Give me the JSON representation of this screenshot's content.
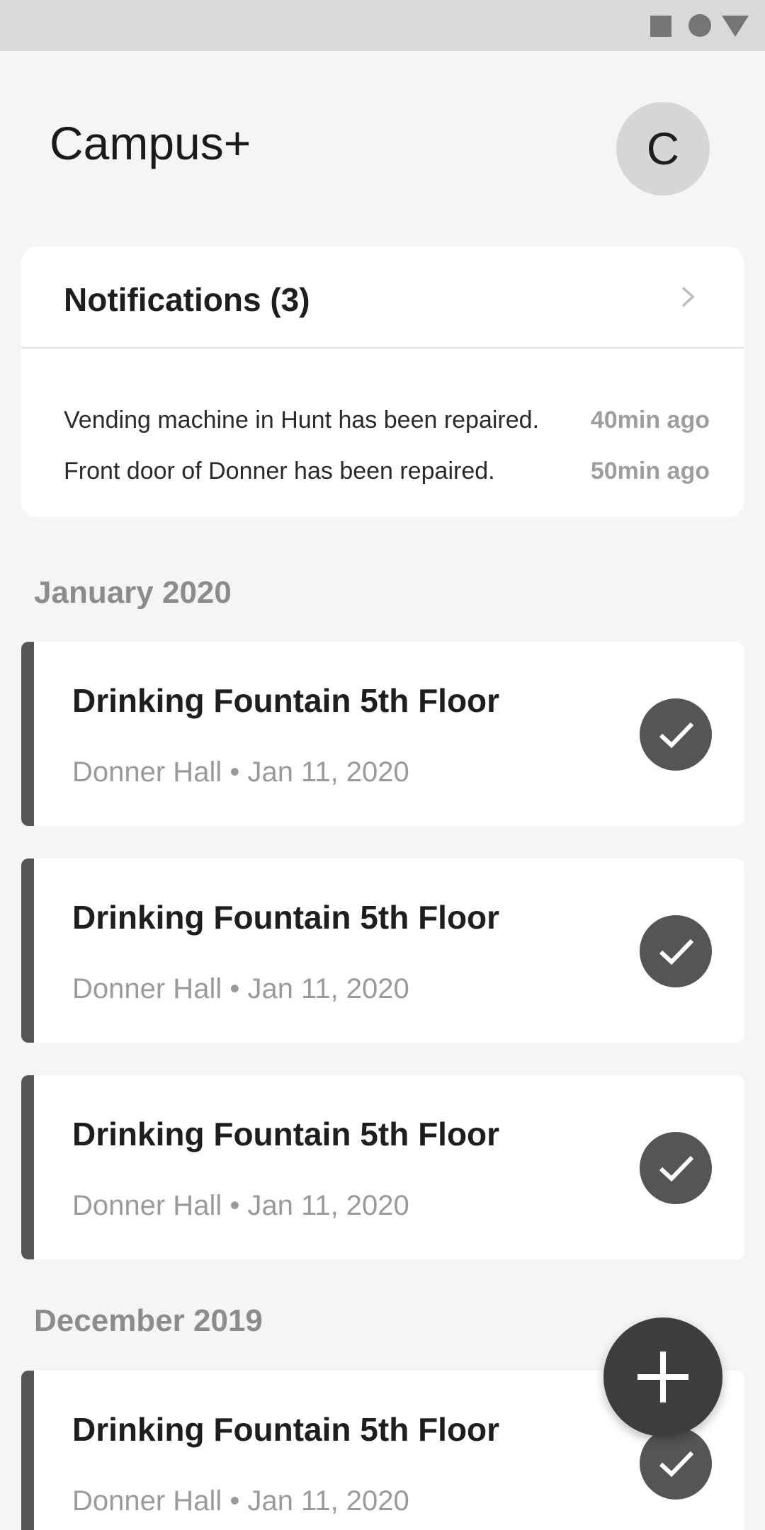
{
  "app": {
    "title": "Campus+",
    "avatar_initial": "C"
  },
  "notifications": {
    "title": "Notifications (3)",
    "items": [
      {
        "message": "Vending machine in Hunt has been repaired.",
        "time": "40min ago"
      },
      {
        "message": "Front door of Donner has been repaired.",
        "time": "50min ago"
      }
    ]
  },
  "sections": [
    {
      "header": "January 2020",
      "reports": [
        {
          "title": "Drinking Fountain 5th Floor",
          "subtitle": "Donner Hall • Jan 11, 2020"
        },
        {
          "title": "Drinking Fountain 5th Floor",
          "subtitle": "Donner Hall • Jan 11, 2020"
        },
        {
          "title": "Drinking Fountain 5th Floor",
          "subtitle": "Donner Hall • Jan 11, 2020"
        }
      ]
    },
    {
      "header": "December 2019",
      "reports": [
        {
          "title": "Drinking Fountain 5th Floor",
          "subtitle": "Donner Hall • Jan 11, 2020"
        }
      ]
    }
  ],
  "icons": {
    "status_bar": [
      "square-icon",
      "circle-icon",
      "triangle-icon"
    ],
    "notifications_arrow": "chevron-right-icon",
    "report_status": "check-icon",
    "fab": "plus-icon"
  },
  "colors": {
    "accent": "#555555",
    "fab": "#3d3d3d",
    "background": "#f5f5f5"
  }
}
